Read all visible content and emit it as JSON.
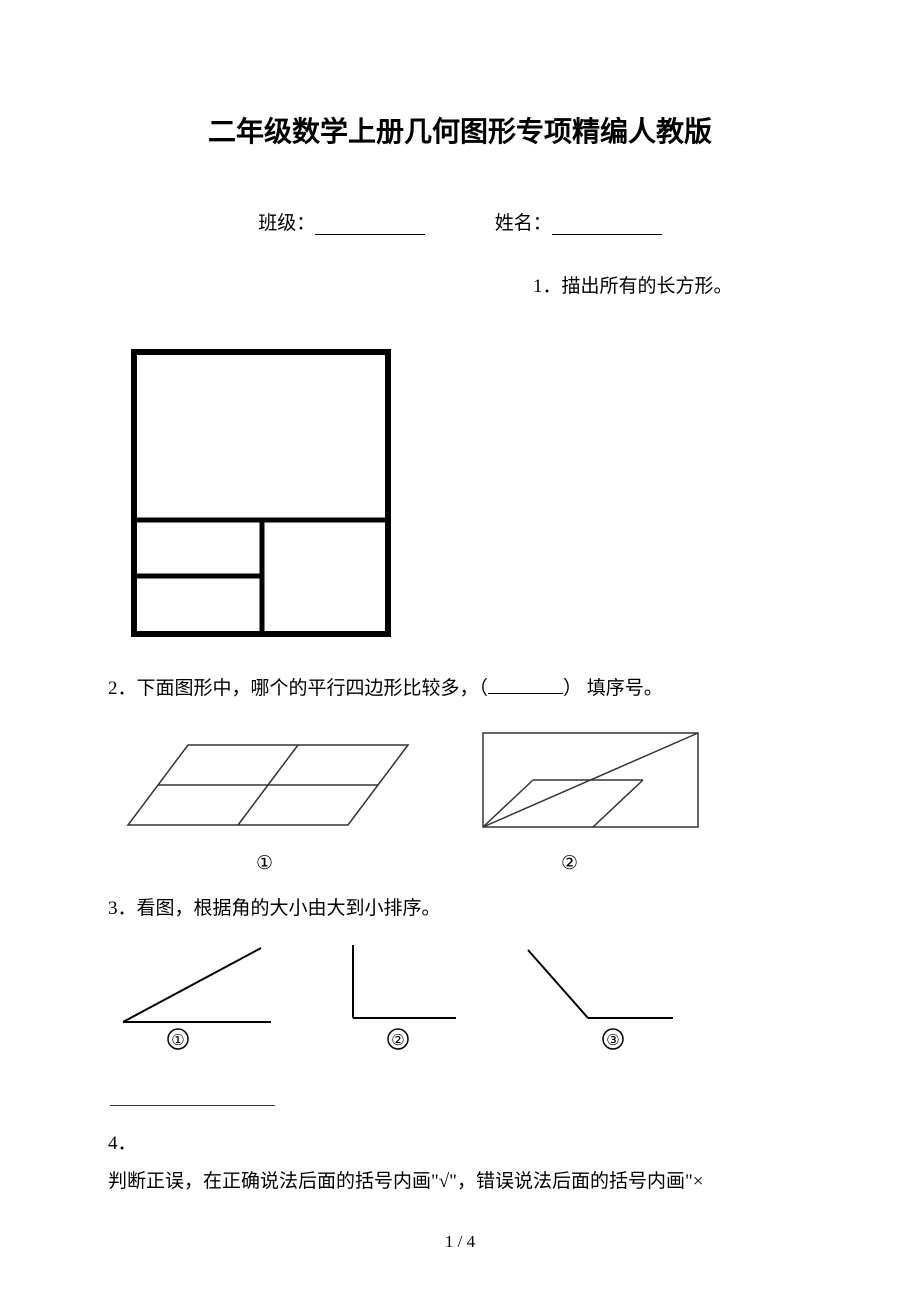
{
  "title": "二年级数学上册几何图形专项精编人教版",
  "info": {
    "class_label": "班级：",
    "name_label": "姓名："
  },
  "q1": "1．描出所有的长方形。",
  "q2": {
    "text_prefix": "2．下面图形中，哪个的平行四边形比较多，（",
    "text_suffix": "） 填序号。",
    "label1": "①",
    "label2": "②"
  },
  "q3": {
    "text": "3．看图，根据角的大小由大到小排序。",
    "a1": "①",
    "a2": "②",
    "a3": "③"
  },
  "q4": {
    "num": "4．",
    "text": "判断正误，在正确说法后面的括号内画\"√\"，错误说法后面的括号内画\"×"
  },
  "page": "1 / 4"
}
